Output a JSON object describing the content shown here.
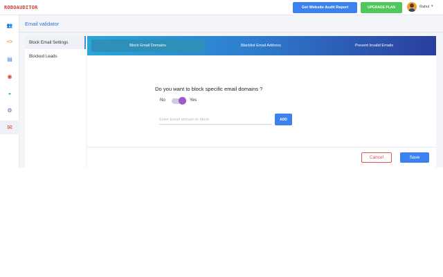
{
  "app": {
    "logo_text": "ROBOAUDITOR"
  },
  "header": {
    "audit_button": "Get Website Audit Report",
    "upgrade_button": "UPGRADE PLAN",
    "user_name": "Rahul",
    "user_caret": "▾"
  },
  "rail": {
    "icons": [
      {
        "name": "users-icon",
        "glyph": "👥",
        "color": "#3b82f0"
      },
      {
        "name": "code-icon",
        "glyph": "</>",
        "color": "#e39b2f"
      },
      {
        "name": "document-icon",
        "glyph": "▤",
        "color": "#3b82f0"
      },
      {
        "name": "target-icon",
        "glyph": "◉",
        "color": "#d9433a"
      },
      {
        "name": "gauge-icon",
        "glyph": "◒",
        "color": "#1f9d8f"
      },
      {
        "name": "settings-icon",
        "glyph": "⚙",
        "color": "#8e44ad"
      },
      {
        "name": "email-block-icon",
        "glyph": "✉",
        "color": "#d9433a"
      }
    ]
  },
  "page": {
    "title": "Email validator"
  },
  "subnav": {
    "items": [
      {
        "label": "Block Email Settings",
        "active": true
      },
      {
        "label": "Blocked Leads",
        "active": false
      }
    ]
  },
  "tabs": [
    {
      "label": "Block Email Domains",
      "active": true
    },
    {
      "label": "Blacklist Email Address",
      "active": false
    },
    {
      "label": "Prevent Invalid Emails",
      "active": false
    }
  ],
  "block_domains": {
    "question": "Do you want to block specific email domains ?",
    "toggle_off_label": "No",
    "toggle_on_label": "Yes",
    "toggle_state": "Yes",
    "input_value": "",
    "input_placeholder": "Enter Email domain to block",
    "add_button": "ADD"
  },
  "footer": {
    "cancel_button": "Cancel",
    "save_button": "Save"
  },
  "colors": {
    "primary": "#3b82f0",
    "success": "#4fc85a",
    "danger": "#d9534f",
    "toggle": "#9b59c9",
    "logo": "#d43a2f"
  }
}
